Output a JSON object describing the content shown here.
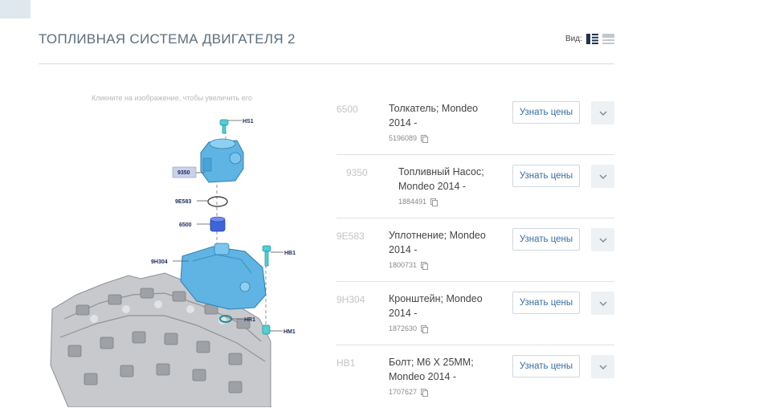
{
  "header": {
    "title": "ТОПЛИВНАЯ СИСТЕМА ДВИГАТЕЛЯ 2",
    "view_label": "Вид:"
  },
  "diagram": {
    "hint": "Кликните на изображение, чтобы увеличить его",
    "callouts": {
      "hs1": "HS1",
      "c9350": "9350",
      "c9e583": "9E583",
      "c6500": "6500",
      "c9h304": "9H304",
      "hb1": "HB1",
      "hr1": "HR1",
      "hm1": "HM1"
    }
  },
  "parts": [
    {
      "code": "6500",
      "name": "Толкатель; Mondeo 2014 -",
      "number": "5196089",
      "button": "Узнать цены"
    },
    {
      "code": "9350",
      "name": "Топливный Насос; Mondeo 2014 -",
      "number": "1884491",
      "button": "Узнать цены"
    },
    {
      "code": "9E583",
      "name": "Уплотнение; Mondeo 2014 -",
      "number": "1800731",
      "button": "Узнать цены"
    },
    {
      "code": "9H304",
      "name": "Кронштейн; Mondeo 2014 -",
      "number": "1872630",
      "button": "Узнать цены"
    },
    {
      "code": "HB1",
      "name": "Болт; M6 X 25MM; Mondeo 2014 -",
      "number": "1707627",
      "button": "Узнать цены"
    }
  ],
  "colors": {
    "accent": "#3a6ea5",
    "part_blue": "#5fb4e3",
    "callout_bg": "#c9d2e8",
    "view_active": "#1f3550"
  },
  "icons": [
    "list-view-icon",
    "grid-view-icon",
    "copy-icon",
    "chevron-down-icon"
  ]
}
